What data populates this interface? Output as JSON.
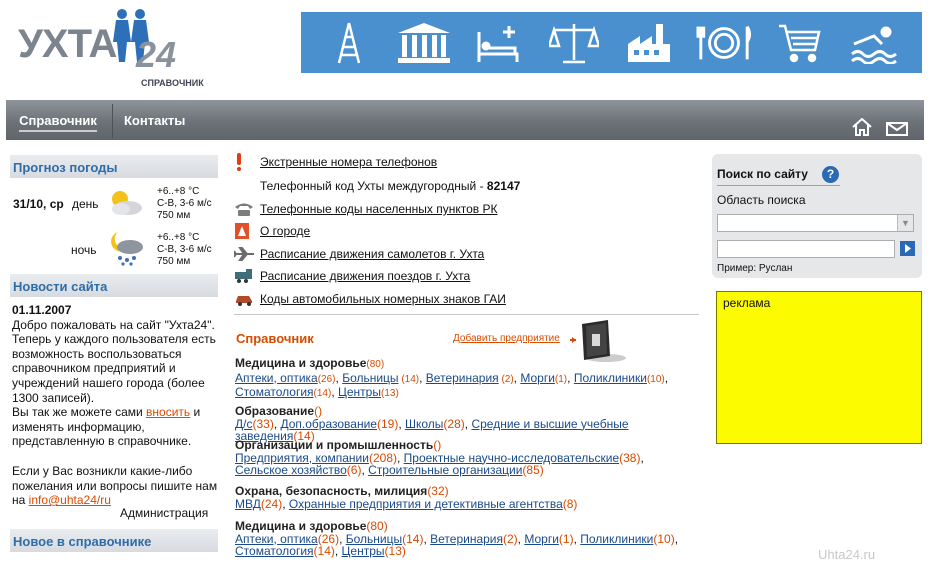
{
  "header": {
    "logo_text": "УХТА",
    "logo_num": "24",
    "logo_sub": "СПРАВОЧНИК",
    "icons": [
      "oil-derrick-icon",
      "government-building-icon",
      "hospital-icon",
      "scales-justice-icon",
      "factory-icon",
      "restaurant-icon",
      "shopping-cart-icon",
      "swimming-icon"
    ]
  },
  "nav": {
    "item1": "Справочник",
    "item2": "Контакты"
  },
  "weather": {
    "title": "Прогноз погоды",
    "date": "31/10, ср",
    "day_label": "день",
    "night_label": "ночь",
    "day_temp": "+6..+8 °С",
    "day_wind": "С-В, 3-6 м/с",
    "day_press": "750 мм",
    "night_temp": "+6..+8 °С",
    "night_wind": "С-В, 3-6 м/с",
    "night_press": "750 мм"
  },
  "news": {
    "title": "Новости сайта",
    "date": "01.11.2007",
    "p1": "Добро пожаловать на сайт  \"Ухта24\". Теперь у каждого пользователя есть возможность воспользоваться справочником предприятий и учреждений нашего города (более 1300 записей).",
    "p2a": "Вы так же можете сами ",
    "p2_link": "вносить",
    "p2b": " и изменять информацию, представленную в справочнике.",
    "p3": "Если у Вас возникли какие-либо пожелания или вопросы пишите нам на",
    "email": "info@uhta24/ru",
    "sign": "Администрация"
  },
  "new_in_directory": {
    "title": "Новое в справочнике"
  },
  "links": {
    "emergency": "Экстренные номера телефонов",
    "phone_code_text": "Телефонный код Ухты междугородный - ",
    "phone_code": "82147",
    "rk_codes": "Телефонные коды населенных пунктов РК",
    "about_city": "О городе",
    "planes": "Расписание движения самолетов г. Ухта",
    "trains": "Расписание движения поездов г. Ухта",
    "car_codes": "Коды автомобильных номерных знаков ГАИ"
  },
  "directory": {
    "title": "Справочник",
    "add": "Добавить предприятие",
    "cat1": {
      "head": "Медицина и здоровье",
      "count": "(80)",
      "items": [
        {
          "name": "Аптеки, оптика",
          "count": "(26)"
        },
        {
          "name": "Больницы",
          "count": " (14)"
        },
        {
          "name": "Ветеринария",
          "count": " (2)"
        },
        {
          "name": "Морги",
          "count": "(1)"
        },
        {
          "name": "Поликлиники",
          "count": "(10)"
        },
        {
          "name": "Стоматология",
          "count": "(14)"
        },
        {
          "name": "Центры",
          "count": "(13)"
        }
      ]
    },
    "cat2": {
      "head": "Образование",
      "count": "()",
      "items": [
        {
          "name": "Д/с",
          "count": "(33)"
        },
        {
          "name": "Доп.образование",
          "count": "(19)"
        },
        {
          "name": "Школы",
          "count": "(28)"
        },
        {
          "name": "Средние и высшие учебные заведения",
          "count": "(14)"
        }
      ]
    },
    "cat3": {
      "head": "Организации и промышленность",
      "count": "()",
      "items": [
        {
          "name": "Предприятия, компании",
          "count": "(208)"
        },
        {
          "name": "Проектные научно-исследовательские",
          "count": "(38)"
        },
        {
          "name": "Сельское хозяйство",
          "count": "(6)"
        },
        {
          "name": "Строительные организации",
          "count": "(85)"
        }
      ]
    },
    "cat4": {
      "head": "Охрана, безопасность, милиция",
      "count": "(32)",
      "items": [
        {
          "name": "МВД",
          "count": "(24)"
        },
        {
          "name": "Охранные предприятия и детективные агентства",
          "count": "(8)"
        }
      ]
    },
    "cat5": {
      "head": "Медицина и здоровье",
      "count": "(80)",
      "items": [
        {
          "name": "Аптеки, оптика",
          "count": "(26)"
        },
        {
          "name": "Больницы",
          "count": "(14)"
        },
        {
          "name": "Ветеринария",
          "count": "(2)"
        },
        {
          "name": "Морги",
          "count": "(1)"
        },
        {
          "name": "Поликлиники",
          "count": "(10)"
        },
        {
          "name": "Стоматология",
          "count": "(14)"
        },
        {
          "name": "Центры",
          "count": "(13)"
        }
      ]
    }
  },
  "search": {
    "title": "Поиск по сайту",
    "help": "?",
    "area_label": "Область поиска",
    "area_value": "",
    "query_value": "",
    "example": "Пример: Руслан"
  },
  "ad": {
    "text": "реклама"
  },
  "watermark": "Uhta24.ru",
  "colors": {
    "accent_blue": "#4a90cf",
    "count_orange": "#d84b00",
    "ad_yellow": "#fdfb00"
  }
}
